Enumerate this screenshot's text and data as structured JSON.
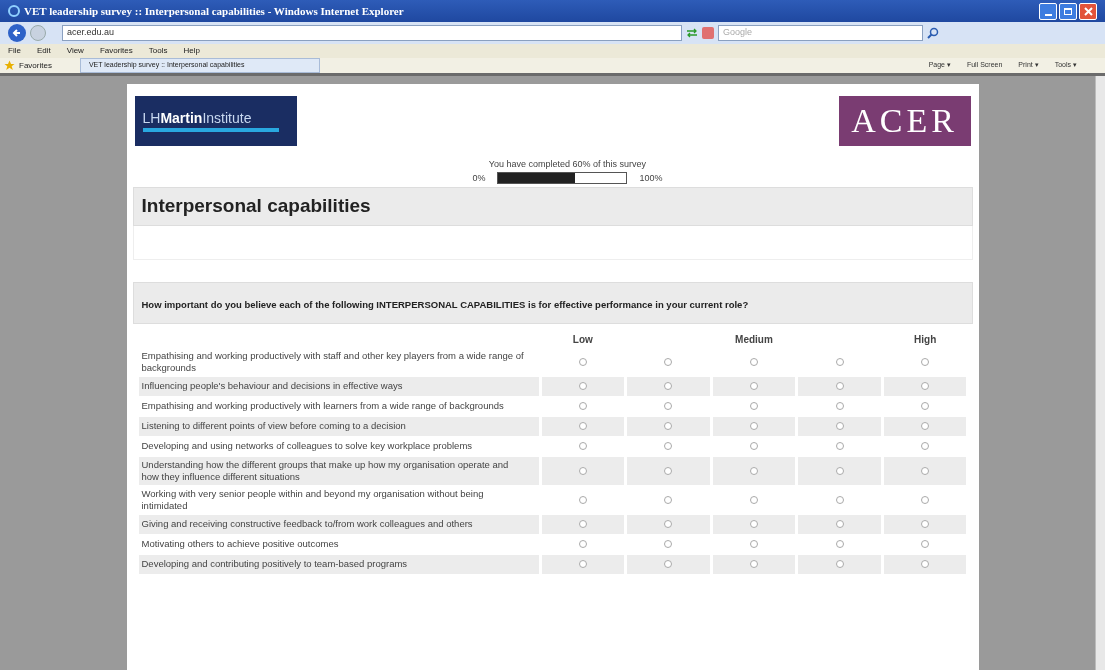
{
  "window": {
    "title": "VET leadership survey :: Interpersonal capabilities - Windows Internet Explorer"
  },
  "address_bar": {
    "value": "acer.edu.au"
  },
  "search": {
    "placeholder": "Google"
  },
  "menu": [
    "File",
    "Edit",
    "View",
    "Favorites",
    "Tools",
    "Help"
  ],
  "favorites_bar": {
    "label": "Favorites",
    "tab": "VET leadership survey :: Interpersonal capabilities",
    "tools": [
      "Page ▾",
      "Full Screen",
      "Print ▾",
      "Tools ▾"
    ]
  },
  "logos": {
    "left": {
      "light1": "LH",
      "bold": "Martin",
      "light2": "Institute"
    },
    "right": "ACER"
  },
  "progress": {
    "text": "You have completed 60% of this survey",
    "min": "0%",
    "max": "100%",
    "level": 0.6
  },
  "section_title": "Interpersonal capabilities",
  "question": "How important do you believe each of the following INTERPERSONAL CAPABILITIES is for effective performance in your current role?",
  "scale": [
    "Low",
    "Medium",
    "High"
  ],
  "rows": [
    {
      "text": "Empathising and working productively with staff and other key players from a wide range of backgrounds",
      "options": [
        {
          "selected": false
        },
        {
          "selected": false
        },
        {
          "selected": false
        },
        {
          "selected": false
        },
        {
          "selected": false
        }
      ]
    },
    {
      "text": "Influencing people's behaviour and decisions in effective ways",
      "options": [
        {
          "selected": false
        },
        {
          "selected": false
        },
        {
          "selected": false
        },
        {
          "selected": false
        },
        {
          "selected": false
        }
      ]
    },
    {
      "text": "Empathising and working productively with learners from a wide range of backgrounds",
      "options": [
        {
          "selected": false
        },
        {
          "selected": false
        },
        {
          "selected": false
        },
        {
          "selected": false
        },
        {
          "selected": false
        }
      ]
    },
    {
      "text": "Listening to different points of view before coming to a decision",
      "options": [
        {
          "selected": false
        },
        {
          "selected": false
        },
        {
          "selected": false
        },
        {
          "selected": false
        },
        {
          "selected": false
        }
      ]
    },
    {
      "text": "Developing and using networks of colleagues to solve key workplace problems",
      "options": [
        {
          "selected": false
        },
        {
          "selected": false
        },
        {
          "selected": false
        },
        {
          "selected": false
        },
        {
          "selected": false
        }
      ]
    },
    {
      "text": "Understanding how the different groups that make up how my organisation operate and how they influence different situations",
      "options": [
        {
          "selected": false
        },
        {
          "selected": false
        },
        {
          "selected": false
        },
        {
          "selected": false
        },
        {
          "selected": false
        }
      ]
    },
    {
      "text": "Working with very senior people within and beyond my organisation without being intimidated",
      "options": [
        {
          "selected": false
        },
        {
          "selected": false
        },
        {
          "selected": false
        },
        {
          "selected": false
        },
        {
          "selected": false
        }
      ]
    },
    {
      "text": "Giving and receiving constructive feedback to/from work colleagues and others",
      "options": [
        {
          "selected": false
        },
        {
          "selected": false
        },
        {
          "selected": false
        },
        {
          "selected": false
        },
        {
          "selected": false
        }
      ]
    },
    {
      "text": "Motivating others to achieve positive outcomes",
      "options": [
        {
          "selected": false
        },
        {
          "selected": false
        },
        {
          "selected": false
        },
        {
          "selected": false
        },
        {
          "selected": false
        }
      ]
    },
    {
      "text": "Developing and contributing positively to team-based programs",
      "options": [
        {
          "selected": false
        },
        {
          "selected": false
        },
        {
          "selected": false
        },
        {
          "selected": false
        },
        {
          "selected": false
        }
      ]
    }
  ]
}
